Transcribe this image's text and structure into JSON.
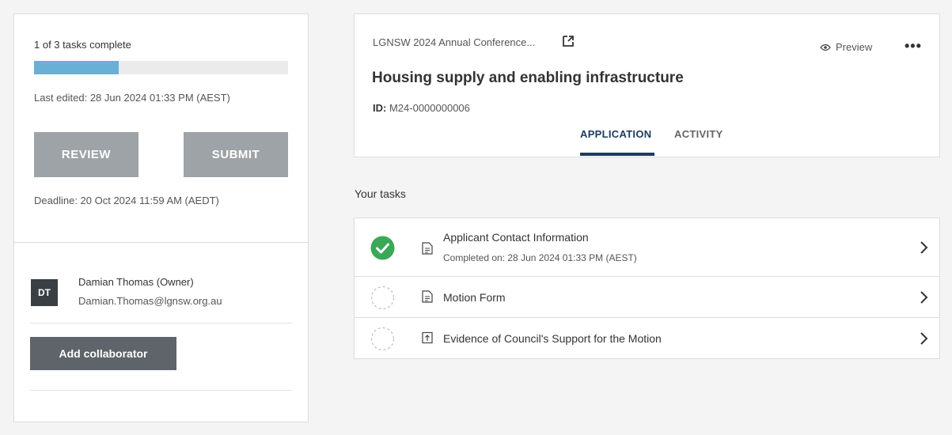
{
  "sidebar": {
    "progress_text": "1 of 3 tasks complete",
    "progress_fraction": 0.333,
    "last_edited": "Last edited: 28 Jun 2024 01:33 PM (AEST)",
    "review_label": "REVIEW",
    "submit_label": "SUBMIT",
    "deadline": "Deadline: 20 Oct 2024 11:59 AM (AEDT)",
    "owner": {
      "initials": "DT",
      "name": "Damian Thomas (Owner)",
      "email": "Damian.Thomas@lgnsw.org.au"
    },
    "add_collaborator_label": "Add collaborator"
  },
  "header": {
    "breadcrumb": "LGNSW 2024 Annual Conference...",
    "preview_label": "Preview",
    "more_label": "•••",
    "title": "Housing supply and enabling infrastructure",
    "id_label": "ID:",
    "id_value": "M24-0000000006",
    "tabs": [
      {
        "label": "APPLICATION",
        "active": true
      },
      {
        "label": "ACTIVITY",
        "active": false
      }
    ]
  },
  "tasks": {
    "heading": "Your tasks",
    "items": [
      {
        "title": "Applicant Contact Information",
        "subtitle": "Completed on: 28 Jun 2024 01:33 PM (AEST)",
        "status": "complete",
        "icon": "document-icon"
      },
      {
        "title": "Motion Form",
        "subtitle": "",
        "status": "incomplete",
        "icon": "document-icon"
      },
      {
        "title": "Evidence of Council's Support for the Motion",
        "subtitle": "",
        "status": "incomplete",
        "icon": "upload-icon"
      }
    ]
  },
  "colors": {
    "progress": "#6aafd6",
    "complete": "#3aa856",
    "tab_active": "#1d3b5e",
    "button_disabled": "#9ea3a7",
    "button_dark": "#5e6469"
  }
}
